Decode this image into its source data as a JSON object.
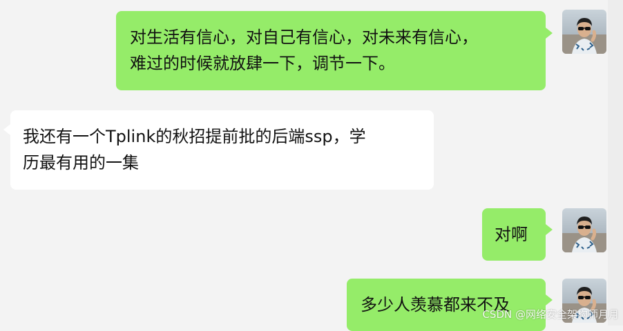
{
  "messages": [
    {
      "side": "out",
      "lines": [
        "对生活有信心，对自己有信心，对未来有信心，",
        "难过的时候就放肆一下，调节一下。"
      ]
    },
    {
      "side": "in",
      "lines": [
        "我还有一个Tplink的秋招提前批的后端ssp，学",
        "历最有用的一集"
      ]
    },
    {
      "side": "out",
      "lines": [
        "对啊"
      ]
    },
    {
      "side": "out",
      "lines": [
        "多少人羡慕都来不及"
      ]
    }
  ],
  "watermark": "CSDN @网络安全架构师月月",
  "colors": {
    "background": "#f3f3f3",
    "outgoing_bubble": "#95ec69",
    "incoming_bubble": "#ffffff"
  },
  "icons": {
    "avatar": "user-avatar-photo"
  }
}
